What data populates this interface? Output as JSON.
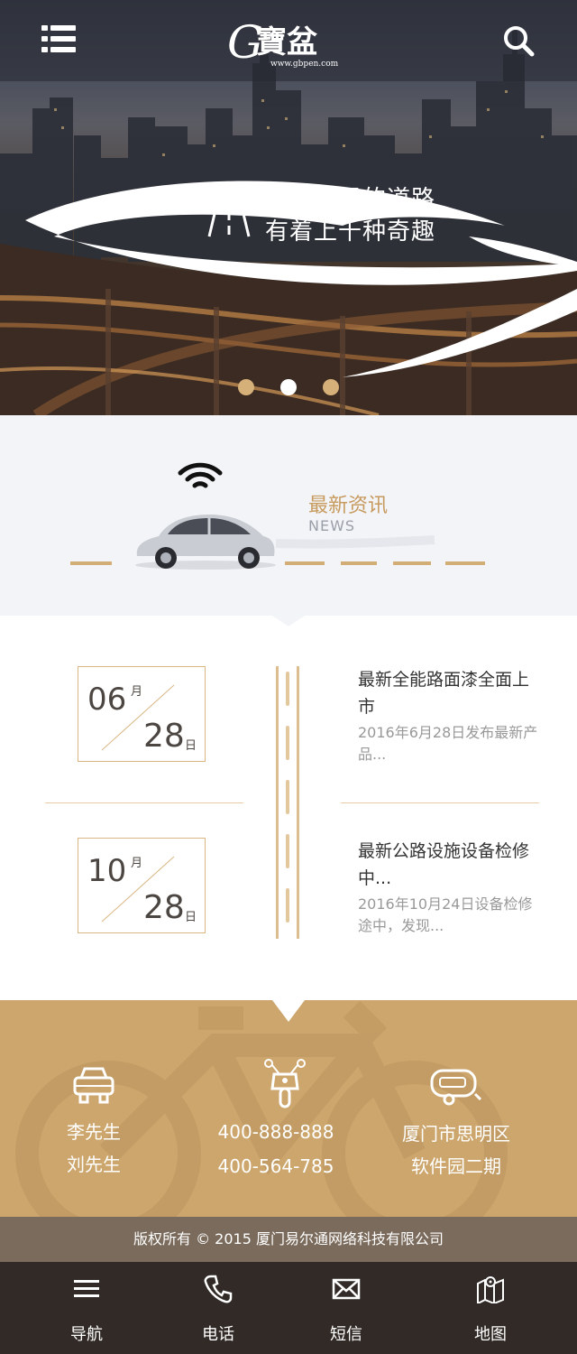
{
  "header": {
    "logo_text": "G寶盆",
    "logo_url": "www.gbpen.com",
    "menu_icon": "list-menu-icon",
    "search_icon": "search-icon"
  },
  "banner": {
    "slogan_line1": "上千英里的道路",
    "slogan_line2": "有着上千种奇趣",
    "active_slide": 2,
    "slide_count": 3
  },
  "news": {
    "title": "最新资讯",
    "subtitle": "NEWS",
    "items": [
      {
        "month": "06",
        "month_unit": "月",
        "day": "28",
        "day_unit": "日",
        "title": "最新全能路面漆全面上市",
        "desc": "2016年6月28日发布最新产品..."
      },
      {
        "month": "10",
        "month_unit": "月",
        "day": "28",
        "day_unit": "日",
        "title": "最新公路设施设备检修中...",
        "desc": "2016年10月24日设备检修途中，发现..."
      }
    ]
  },
  "contact": {
    "people": [
      "李先生",
      "刘先生"
    ],
    "phones": [
      "400-888-888",
      "400-564-785"
    ],
    "address": [
      "厦门市思明区",
      "软件园二期"
    ]
  },
  "footer": {
    "copyright": "版权所有 © 2015 厦门易尔通网络科技有限公司"
  },
  "bottom_nav": [
    {
      "label": "导航",
      "icon": "hamburger-icon"
    },
    {
      "label": "电话",
      "icon": "phone-icon"
    },
    {
      "label": "短信",
      "icon": "envelope-icon"
    },
    {
      "label": "地图",
      "icon": "map-icon"
    }
  ],
  "colors": {
    "accent": "#cca66c",
    "footer_band": "#7b6b5c",
    "nav_bg": "#312a26"
  }
}
